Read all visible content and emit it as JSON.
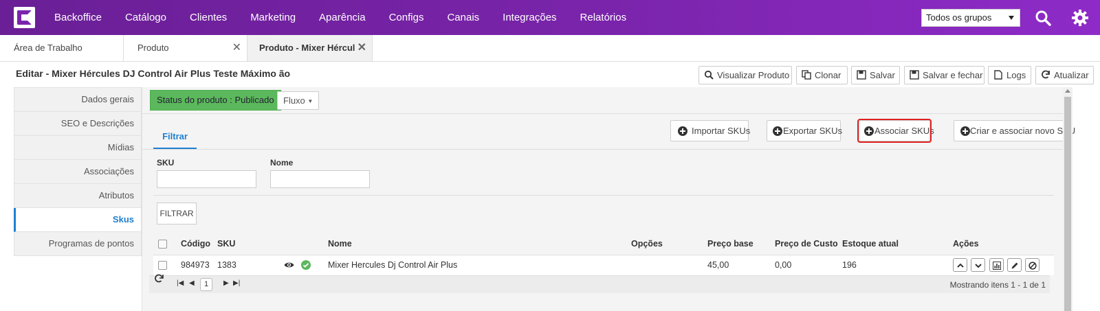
{
  "topnav": {
    "menu": [
      "Backoffice",
      "Catálogo",
      "Clientes",
      "Marketing",
      "Aparência",
      "Configs",
      "Canais",
      "Integrações",
      "Relatórios"
    ],
    "group_select": "Todos os grupos"
  },
  "tabs": [
    {
      "label": "Área de Trabalho"
    },
    {
      "label": "Produto",
      "close": "✕"
    },
    {
      "label": "Produto - Mixer Hércules",
      "close": "✕"
    }
  ],
  "page": {
    "title": "Editar - Mixer Hércules DJ Control Air Plus Teste Máximo ão"
  },
  "toolbar": {
    "visualizar": "Visualizar Produto",
    "clonar": "Clonar",
    "salvar": "Salvar",
    "salvar_fechar": "Salvar e fechar",
    "logs": "Logs",
    "atualizar": "Atualizar"
  },
  "sidebar": {
    "items": [
      "Dados gerais",
      "SEO e Descrições",
      "Mídias",
      "Associações",
      "Atributos",
      "Skus",
      "Programas de pontos"
    ],
    "active": "Skus"
  },
  "status": {
    "label": "Status do produto : Publicado",
    "fluxo": "Fluxo"
  },
  "subtabs": {
    "filtrar": "Filtrar"
  },
  "actions": {
    "importar": "Importar SKUs",
    "exportar": "Exportar SKUs",
    "associar": "Associar SKUs",
    "criar": "Criar e associar novo SKU"
  },
  "filters": {
    "sku_label": "SKU",
    "nome_label": "Nome",
    "button": "FILTRAR"
  },
  "grid": {
    "columns": [
      "Código",
      "SKU",
      "Nome",
      "Opções",
      "Preço base",
      "Preço de Custo",
      "Estoque atual",
      "Ações"
    ],
    "rows": [
      {
        "codigo": "984973",
        "sku": "1383",
        "nome": "Mixer Hercules Dj Control Air Plus",
        "opcoes": "",
        "preco_base": "45,00",
        "preco_custo": "0,00",
        "estoque": "196"
      }
    ]
  },
  "pager": {
    "page": "1",
    "info": "Mostrando itens 1 - 1 de 1"
  },
  "colors": {
    "nav_start": "#6a1f96",
    "nav_end": "#8e2bc8",
    "accent": "#1f7fd0",
    "status_green": "#5cb85c",
    "highlight_red": "#e02020"
  }
}
